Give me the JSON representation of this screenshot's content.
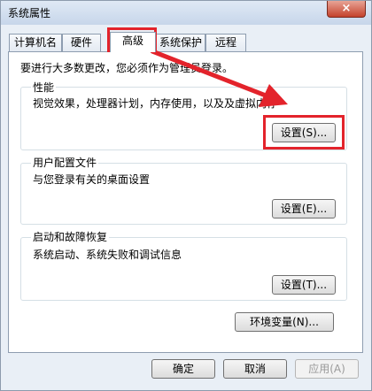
{
  "window": {
    "title": "系统属性",
    "close_glyph": "×"
  },
  "tabs": [
    {
      "label": "计算机名"
    },
    {
      "label": "硬件"
    },
    {
      "label": "高级",
      "active": true
    },
    {
      "label": "系统保护"
    },
    {
      "label": "远程"
    }
  ],
  "admin_note": "要进行大多数更改，您必须作为管理员登录。",
  "performance": {
    "title": "性能",
    "description": "视觉效果，处理器计划，内存使用，以及及虚拟内存",
    "button": "设置(S)..."
  },
  "user_profiles": {
    "title": "用户配置文件",
    "description": "与您登录有关的桌面设置",
    "button": "设置(E)..."
  },
  "startup_recovery": {
    "title": "启动和故障恢复",
    "description": "系统启动、系统失败和调试信息",
    "button": "设置(T)..."
  },
  "env_button": "环境变量(N)...",
  "footer": {
    "ok": "确定",
    "cancel": "取消",
    "apply": "应用(A)"
  },
  "annotation_color": "#e3232b"
}
